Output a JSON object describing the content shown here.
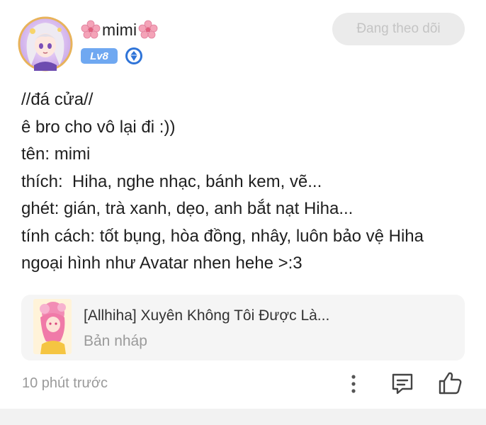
{
  "author": {
    "name": "mimi",
    "level": "Lv8",
    "follow_label": "Đang theo dõi",
    "avatar_icon": "anime-girl-avatar",
    "decor_icon": "cherry-blossom-icon",
    "badge_icon": "diamond-verified-icon"
  },
  "post": {
    "lines": [
      "//đá cửa//",
      "ê bro cho vô lại đi :))",
      "tên: mimi",
      "thích:  Hiha, nghe nhạc, bánh kem, vẽ...",
      "ghét: gián, trà xanh, dẹo, anh bắt nạt Hiha...",
      "tính cách: tốt bụng, hòa đồng, nhây, luôn bảo vệ Hiha",
      "ngoại hình như Avatar nhen hehe >:3"
    ]
  },
  "attachment": {
    "title": "[Allhiha] Xuyên Không Tôi Được Là...",
    "status": "Bản nháp",
    "thumb_icon": "book-cover-thumbnail"
  },
  "footer": {
    "timestamp": "10 phút trước",
    "icons": [
      "more-vertical-icon",
      "comment-icon",
      "like-icon"
    ]
  },
  "colors": {
    "level_badge": "#6fa8f1",
    "follow_bg": "#ebebeb",
    "follow_text": "#c4c4c4",
    "muted_text": "#9a9a9a",
    "card_bg": "#f5f5f5",
    "blossom": "#f4a3b8"
  }
}
